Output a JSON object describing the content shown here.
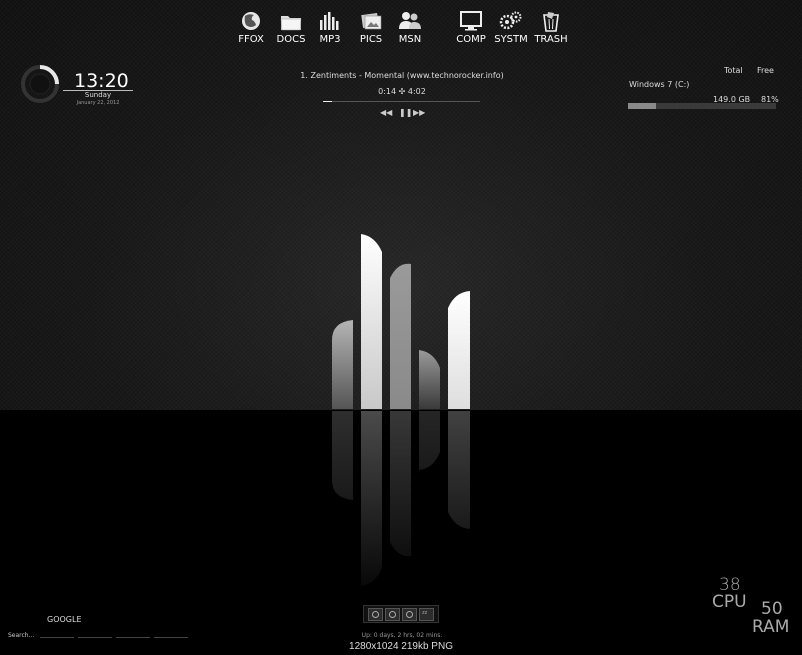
{
  "dock": {
    "items": [
      {
        "label": "FFOX",
        "icon": "firefox-icon"
      },
      {
        "label": "DOCS",
        "icon": "folder-icon"
      },
      {
        "label": "MP3",
        "icon": "equalizer-icon"
      },
      {
        "label": "PICS",
        "icon": "pictures-icon"
      },
      {
        "label": "MSN",
        "icon": "people-icon"
      },
      {
        "label": "COMP",
        "icon": "monitor-icon"
      },
      {
        "label": "SYSTM",
        "icon": "gears-icon"
      },
      {
        "label": "TRASH",
        "icon": "trash-icon"
      }
    ]
  },
  "clock": {
    "time": "13:20",
    "day": "Sunday",
    "date": "January 22, 2012"
  },
  "player": {
    "track": "1. Zentiments - Momental (www.technorocker.info)",
    "time": "0:14 ✣ 4:02",
    "progress": 0.06,
    "controls": {
      "prev": "prev-icon",
      "pause": "pause-icon",
      "next": "next-icon"
    }
  },
  "drive": {
    "header_total": "Total",
    "header_free": "Free",
    "name": "Windows 7 (C:)",
    "total": "149.0 GB",
    "free_percent": "81%",
    "used_fraction": 0.19
  },
  "search": {
    "title": "GOOGLE",
    "label": "Search..."
  },
  "power": {
    "buttons": [
      "power-icon",
      "restart-icon",
      "logoff-icon",
      "sleep-icon"
    ]
  },
  "uptime": "Up: 0 days, 2 hrs, 02 mins.",
  "meters": {
    "cpu_value": "38",
    "cpu_label": "CPU",
    "ram_value": "50",
    "ram_label": "RAM"
  },
  "caption": "1280x1024  219kb  PNG",
  "colors": {
    "background": "#0b0b0b",
    "text": "#dddddd"
  }
}
